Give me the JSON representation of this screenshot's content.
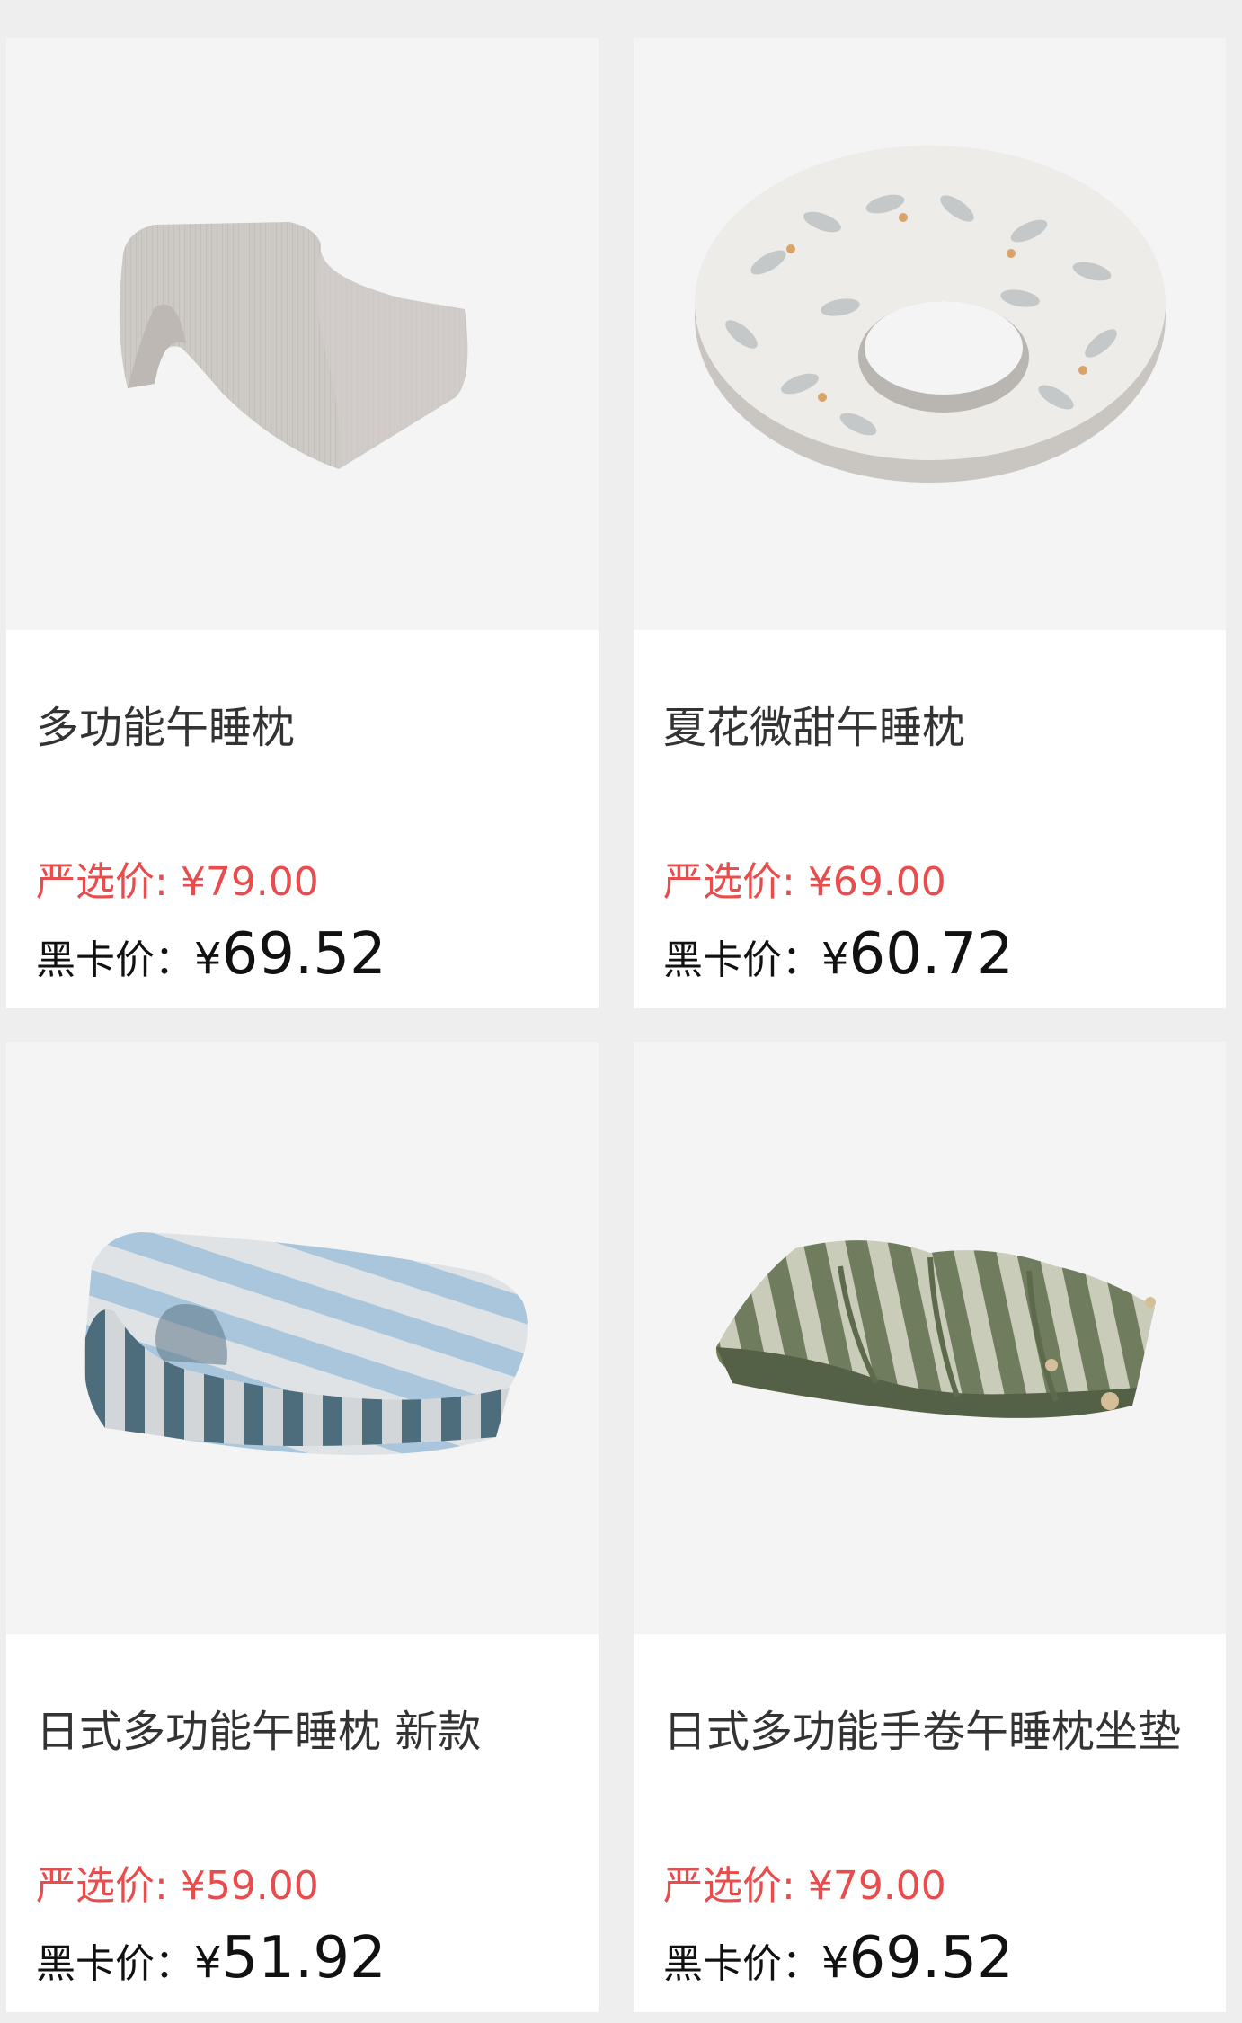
{
  "colors": {
    "page_bg": "#eeeeee",
    "card_bg": "#ffffff",
    "image_bg": "#f4f4f4",
    "yanxuan_price": "#e84c4c",
    "black_card_price": "#111111"
  },
  "products": [
    {
      "name": "多功能午睡枕",
      "yanxuan_label": "严选价:",
      "yanxuan_price": "¥79.00",
      "black_card_label": "黑卡价：",
      "black_card_currency": "¥",
      "black_card_price": "69.52",
      "image_icon": "gray-nap-pillow"
    },
    {
      "name": "夏花微甜午睡枕",
      "yanxuan_label": "严选价:",
      "yanxuan_price": "¥69.00",
      "black_card_label": "黑卡价：",
      "black_card_currency": "¥",
      "black_card_price": "60.72",
      "image_icon": "leaf-print-u-pillow"
    },
    {
      "name": "日式多功能午睡枕  新款",
      "yanxuan_label": "严选价:",
      "yanxuan_price": "¥59.00",
      "black_card_label": "黑卡价：",
      "black_card_currency": "¥",
      "black_card_price": "51.92",
      "image_icon": "blue-striped-nap-pillow"
    },
    {
      "name": "日式多功能手卷午睡枕坐垫",
      "yanxuan_label": "严选价:",
      "yanxuan_price": "¥79.00",
      "black_card_label": "黑卡价：",
      "black_card_currency": "¥",
      "black_card_price": "69.52",
      "image_icon": "green-striped-cushion"
    }
  ]
}
